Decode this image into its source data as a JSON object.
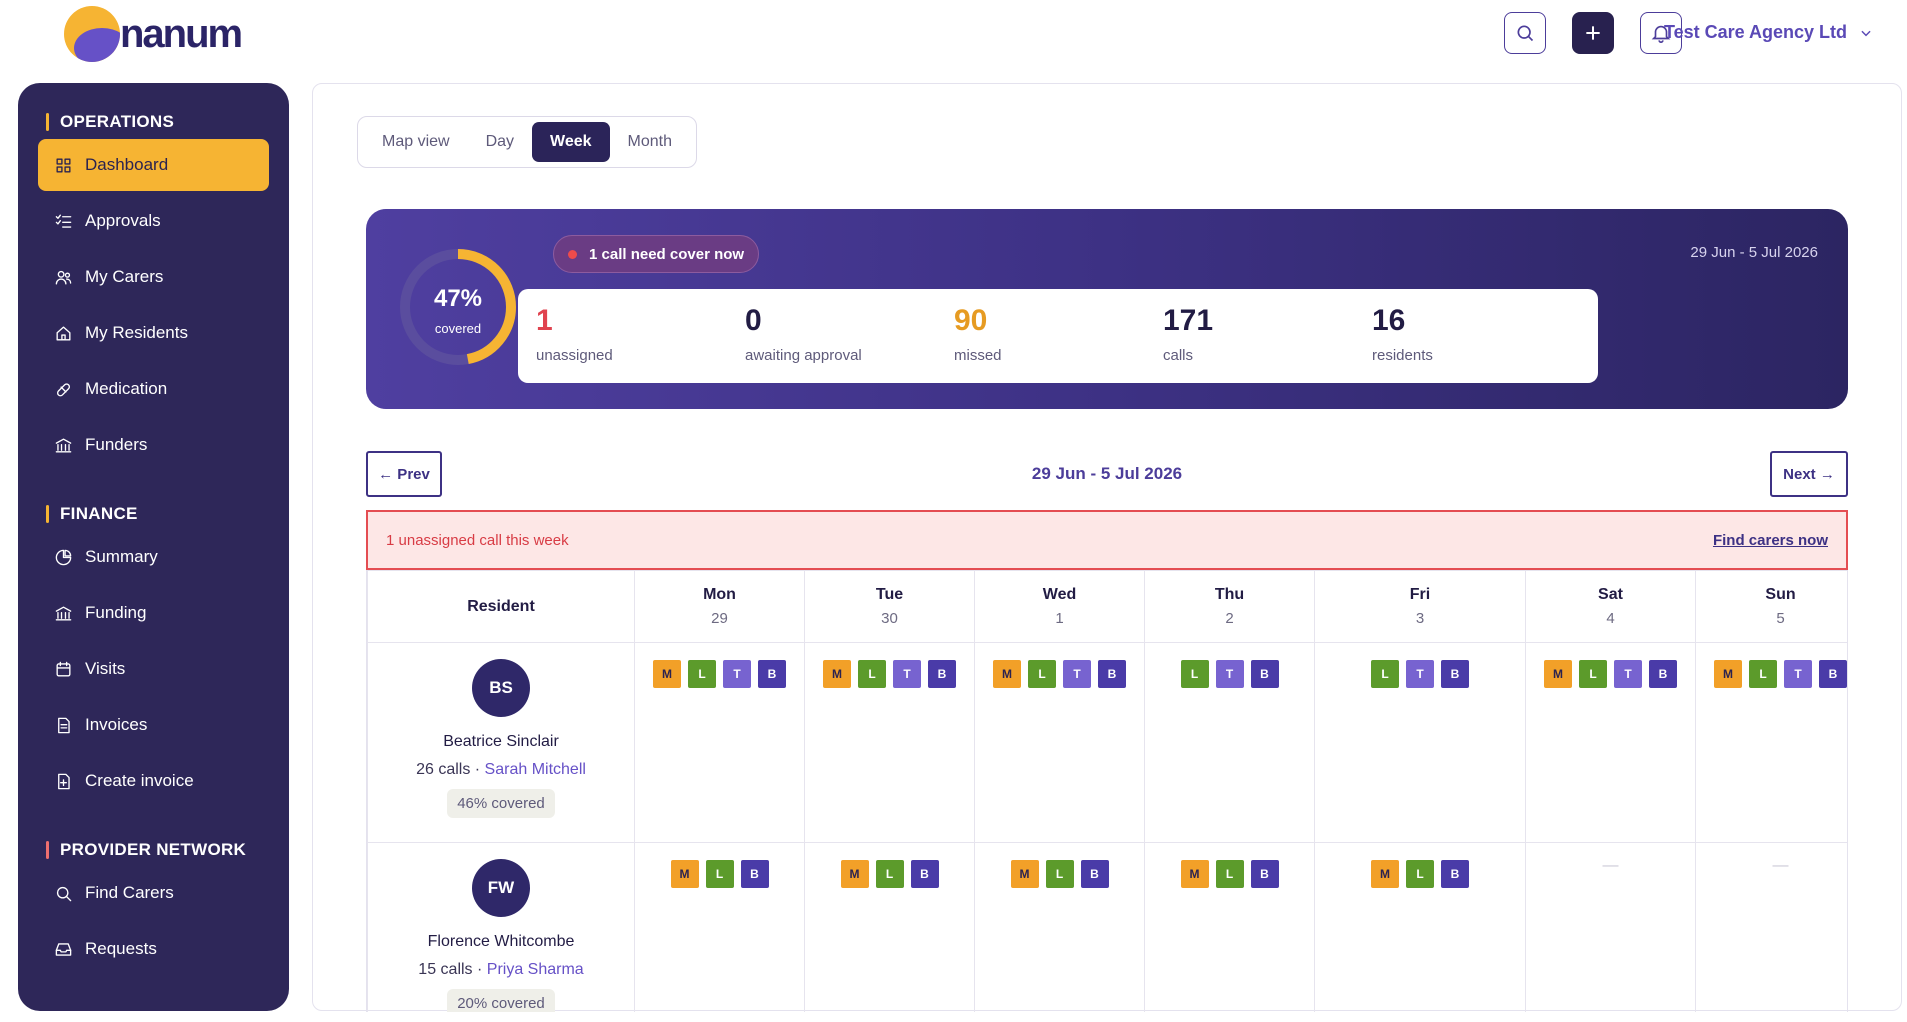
{
  "brand": {
    "name": "nanum"
  },
  "topbar": {
    "agency": "Test Care Agency Ltd"
  },
  "sidebar": {
    "sections": [
      {
        "title": "OPERATIONS",
        "items": [
          {
            "label": "Dashboard",
            "icon": "grid-icon",
            "active": true
          },
          {
            "label": "Approvals",
            "icon": "checklist-icon"
          },
          {
            "label": "My Carers",
            "icon": "users-icon"
          },
          {
            "label": "My Residents",
            "icon": "home-icon"
          },
          {
            "label": "Medication",
            "icon": "pill-icon"
          },
          {
            "label": "Funders",
            "icon": "bank-icon"
          }
        ]
      },
      {
        "title": "FINANCE",
        "items": [
          {
            "label": "Summary",
            "icon": "pie-chart-icon"
          },
          {
            "label": "Funding",
            "icon": "bank-icon"
          },
          {
            "label": "Visits",
            "icon": "calendar-icon"
          },
          {
            "label": "Invoices",
            "icon": "document-icon"
          },
          {
            "label": "Create invoice",
            "icon": "document-plus-icon"
          }
        ]
      },
      {
        "title": "PROVIDER NETWORK",
        "items": [
          {
            "label": "Find Carers",
            "icon": "search-icon"
          },
          {
            "label": "Requests",
            "icon": "inbox-icon"
          }
        ]
      }
    ]
  },
  "tabs": [
    {
      "label": "Map view"
    },
    {
      "label": "Day"
    },
    {
      "label": "Week",
      "active": true
    },
    {
      "label": "Month"
    }
  ],
  "hero": {
    "coverage_pct": "47%",
    "coverage_fraction": 0.47,
    "coverage_label": "covered",
    "alert": "1 call need cover now",
    "range": "29 Jun - 5 Jul 2026",
    "stats": [
      {
        "num": "1",
        "label": "unassigned",
        "color": "#e0434f"
      },
      {
        "num": "0",
        "label": "awaiting approval",
        "color": "#221c44"
      },
      {
        "num": "90",
        "label": "missed",
        "color": "#e69b22"
      },
      {
        "num": "171",
        "label": "calls",
        "color": "#221c44"
      },
      {
        "num": "16",
        "label": "residents",
        "color": "#221c44"
      }
    ]
  },
  "weeknav": {
    "prev": "← Prev",
    "next": "Next →",
    "range": "29 Jun - 5 Jul 2026"
  },
  "banner": {
    "message": "1 unassigned call this week",
    "link": "Find carers now"
  },
  "table": {
    "resident_header": "Resident",
    "days": [
      {
        "name": "Mon",
        "num": "29"
      },
      {
        "name": "Tue",
        "num": "30"
      },
      {
        "name": "Wed",
        "num": "1"
      },
      {
        "name": "Thu",
        "num": "2"
      },
      {
        "name": "Fri",
        "num": "3"
      },
      {
        "name": "Sat",
        "num": "4"
      },
      {
        "name": "Sun",
        "num": "5"
      }
    ],
    "rows": [
      {
        "initials": "BS",
        "name": "Beatrice Sinclair",
        "calls": "26 calls",
        "sep": " · ",
        "carer": "Sarah Mitchell",
        "coverage": "46% covered",
        "days": [
          [
            "M",
            "L",
            "T",
            "B"
          ],
          [
            "M",
            "L",
            "T",
            "B"
          ],
          [
            "M",
            "L",
            "T",
            "B"
          ],
          [
            "L",
            "T",
            "B"
          ],
          [
            "L",
            "T",
            "B"
          ],
          [
            "M",
            "L",
            "T",
            "B"
          ],
          [
            "M",
            "L",
            "T",
            "B"
          ]
        ]
      },
      {
        "initials": "FW",
        "name": "Florence Whitcombe",
        "calls": "15 calls",
        "sep": " · ",
        "carer": "Priya Sharma",
        "coverage": "20% covered",
        "days": [
          [
            "M",
            "L",
            "B"
          ],
          [
            "M",
            "L",
            "B"
          ],
          [
            "M",
            "L",
            "B"
          ],
          [
            "M",
            "L",
            "B"
          ],
          [
            "M",
            "L",
            "B"
          ],
          [],
          []
        ]
      }
    ],
    "empty_mark": "—"
  }
}
